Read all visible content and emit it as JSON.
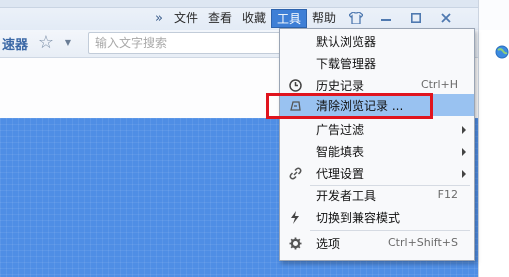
{
  "menubar": {
    "more": "»",
    "items": [
      "文件",
      "查看",
      "收藏",
      "工具",
      "帮助"
    ],
    "active_index": 3
  },
  "window_controls": {
    "skin": "shirt-icon",
    "minimize": "—",
    "maximize": "□",
    "close": "✕"
  },
  "toolbar": {
    "speed_label": "速器",
    "star": "☆",
    "dropdown": "▼",
    "search_placeholder": "输入文字搜索"
  },
  "tools_menu": {
    "items": [
      {
        "label": "默认浏览器",
        "icon": "",
        "shortcut": "",
        "submenu": false
      },
      {
        "label": "下载管理器",
        "icon": "",
        "shortcut": "",
        "submenu": false
      },
      {
        "label": "历史记录",
        "icon": "clock-icon",
        "shortcut": "Ctrl+H",
        "submenu": false
      },
      {
        "label": "清除浏览记录 ...",
        "icon": "eraser-icon",
        "shortcut": "",
        "submenu": false,
        "highlighted": true
      },
      {
        "label": "广告过滤",
        "icon": "",
        "shortcut": "",
        "submenu": true
      },
      {
        "label": "智能填表",
        "icon": "",
        "shortcut": "",
        "submenu": true
      },
      {
        "label": "代理设置",
        "icon": "link-icon",
        "shortcut": "",
        "submenu": true
      },
      {
        "label": "开发者工具",
        "icon": "",
        "shortcut": "F12",
        "submenu": false
      },
      {
        "label": "切换到兼容模式",
        "icon": "lightning-icon",
        "shortcut": "",
        "submenu": false
      },
      {
        "label": "选项",
        "icon": "gear-icon",
        "shortcut": "Ctrl+Shift+S",
        "submenu": false
      }
    ]
  },
  "colors": {
    "accent": "#3e7fd6",
    "highlight": "#99c2f1",
    "annotation": "#e0141e",
    "content_blue": "#4f8ee5"
  }
}
